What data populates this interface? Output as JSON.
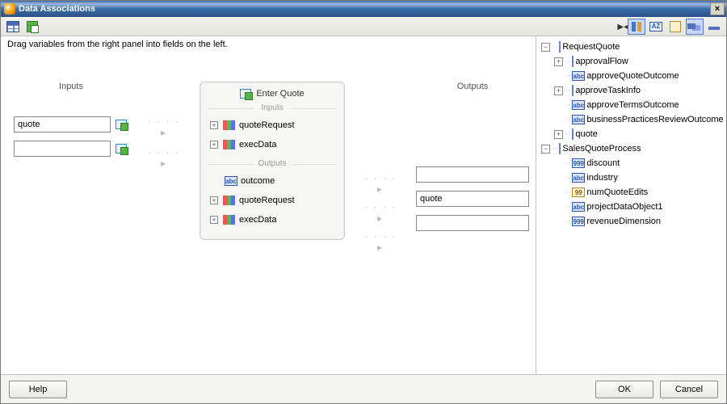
{
  "window": {
    "title": "Data Associations",
    "close_glyph": "×"
  },
  "toolbar": {
    "left": [
      {
        "name": "mapping-view-icon"
      },
      {
        "name": "new-mapping-icon"
      }
    ],
    "right": [
      {
        "name": "sort-icon",
        "active": true
      },
      {
        "name": "alpha-sort-icon"
      },
      {
        "name": "notes-icon"
      },
      {
        "name": "layout-icon",
        "active": true
      },
      {
        "name": "collapse-icon"
      }
    ]
  },
  "hint": "Drag variables from the right panel into fields on the left.",
  "columns": {
    "inputs_label": "Inputs",
    "outputs_label": "Outputs"
  },
  "input_fields": [
    {
      "value": "quote"
    },
    {
      "value": ""
    }
  ],
  "output_fields": [
    {
      "value": ""
    },
    {
      "value": "quote"
    },
    {
      "value": ""
    }
  ],
  "center": {
    "title": "Enter Quote",
    "inputs_label": "Inputs",
    "outputs_label": "Outputs",
    "inputs": [
      {
        "icon": "multi",
        "label": "quoteRequest",
        "expandable": true
      },
      {
        "icon": "multi",
        "label": "execData",
        "expandable": true
      }
    ],
    "outputs": [
      {
        "icon": "abc",
        "label": "outcome",
        "expandable": false
      },
      {
        "icon": "multi",
        "label": "quoteRequest",
        "expandable": true
      },
      {
        "icon": "multi",
        "label": "execData",
        "expandable": true
      }
    ]
  },
  "tree": {
    "roots": [
      {
        "name": "RequestQuote",
        "icon": "box",
        "expanded": true,
        "children": [
          {
            "name": "approvalFlow",
            "icon": "box",
            "expandable": true
          },
          {
            "name": "approveQuoteOutcome",
            "icon": "abc"
          },
          {
            "name": "approveTaskInfo",
            "icon": "box",
            "expandable": true
          },
          {
            "name": "approveTermsOutcome",
            "icon": "abc"
          },
          {
            "name": "businessPracticesReviewOutcome",
            "icon": "abc"
          },
          {
            "name": "quote",
            "icon": "box",
            "expandable": true
          }
        ]
      },
      {
        "name": "SalesQuoteProcess",
        "icon": "box",
        "expanded": true,
        "children": [
          {
            "name": "discount",
            "icon": "num"
          },
          {
            "name": "industry",
            "icon": "abc"
          },
          {
            "name": "numQuoteEdits",
            "icon": "numkey"
          },
          {
            "name": "projectDataObject1",
            "icon": "abc"
          },
          {
            "name": "revenueDimension",
            "icon": "num"
          }
        ]
      }
    ]
  },
  "footer": {
    "help": "Help",
    "ok": "OK",
    "cancel": "Cancel"
  }
}
